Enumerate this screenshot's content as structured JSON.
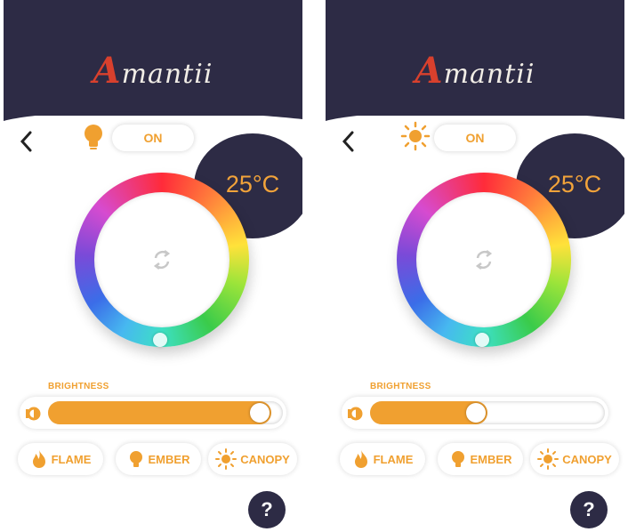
{
  "screens": [
    {
      "logo": "Amantii",
      "power": "ON",
      "mode_icon": "bulb-icon",
      "temperature": "25°C",
      "brightness": {
        "label": "BRIGHTNESS",
        "level": 0.95
      },
      "modes": [
        {
          "label": "FLAME",
          "icon": "flame-icon"
        },
        {
          "label": "EMBER",
          "icon": "bulb-icon"
        },
        {
          "label": "CANOPY",
          "icon": "sun-icon"
        }
      ],
      "help": "?"
    },
    {
      "logo": "Amantii",
      "power": "ON",
      "mode_icon": "sun-icon",
      "temperature": "25°C",
      "brightness": {
        "label": "BRIGHTNESS",
        "level": 0.5
      },
      "modes": [
        {
          "label": "FLAME",
          "icon": "flame-icon"
        },
        {
          "label": "EMBER",
          "icon": "bulb-icon"
        },
        {
          "label": "CANOPY",
          "icon": "sun-icon"
        }
      ],
      "help": "?"
    }
  ],
  "colors": {
    "navy": "#2d2b45",
    "accent": "#f0a030",
    "logo_red": "#d8402d"
  }
}
